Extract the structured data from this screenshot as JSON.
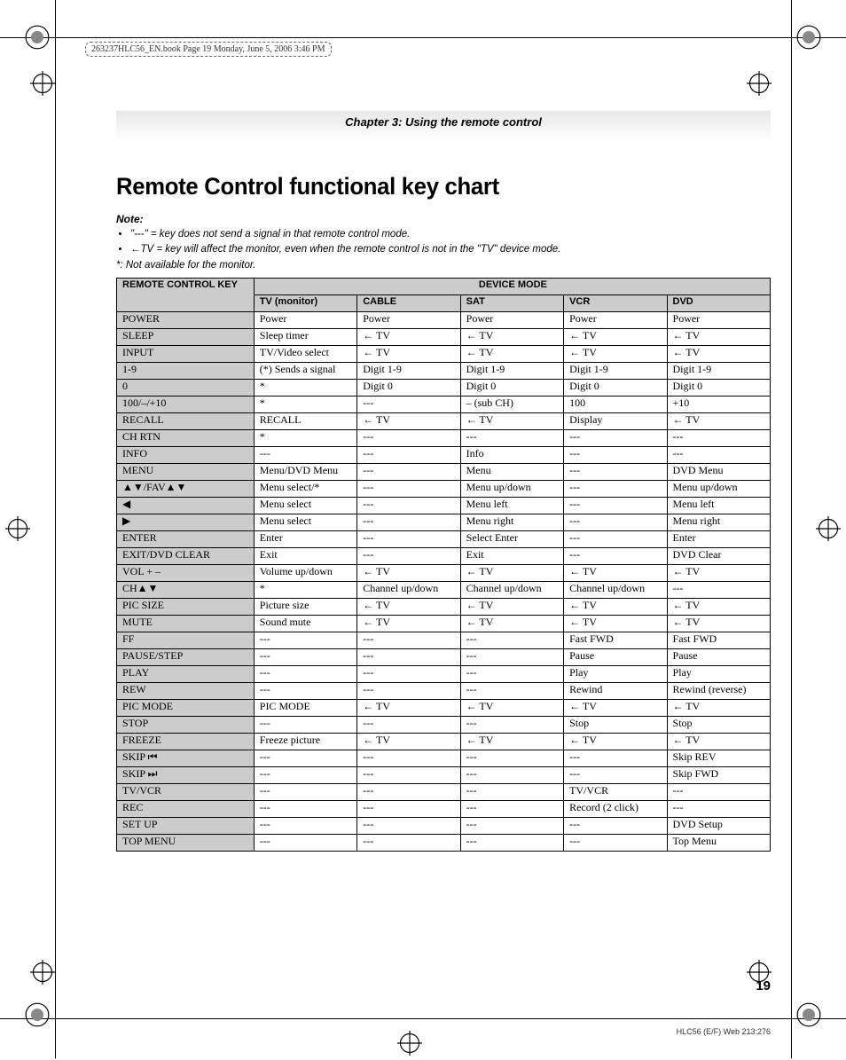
{
  "header_dashed": "263237HLC56_EN.book  Page 19  Monday, June 5, 2006  3:46 PM",
  "chapter": "Chapter 3: Using the remote control",
  "title": "Remote Control functional key chart",
  "note_head": "Note:",
  "notes": [
    "\"---\" = key does not send a signal in that remote control mode.",
    "←TV = key will affect the monitor, even when the remote control is not in the \"TV\" device mode."
  ],
  "note_asterisk": "*: Not available for the monitor.",
  "headers": {
    "remote_key": "REMOTE CONTROL KEY",
    "device_mode": "DEVICE MODE",
    "tv": "TV (monitor)",
    "cable": "CABLE",
    "sat": "SAT",
    "vcr": "VCR",
    "dvd": "DVD"
  },
  "chart_data": {
    "type": "table",
    "columns": [
      "REMOTE CONTROL KEY",
      "TV (monitor)",
      "CABLE",
      "SAT",
      "VCR",
      "DVD"
    ],
    "rows": [
      [
        "POWER",
        "Power",
        "Power",
        "Power",
        "Power",
        "Power"
      ],
      [
        "SLEEP",
        "Sleep timer",
        "← TV",
        "← TV",
        "← TV",
        "← TV"
      ],
      [
        "INPUT",
        "TV/Video select",
        "← TV",
        "← TV",
        "← TV",
        "← TV"
      ],
      [
        "1-9",
        "(*) Sends a signal",
        "Digit 1-9",
        "Digit 1-9",
        "Digit 1-9",
        "Digit 1-9"
      ],
      [
        "0",
        "*",
        "Digit 0",
        "Digit 0",
        "Digit 0",
        "Digit 0"
      ],
      [
        "100/–/+10",
        "*",
        "---",
        "– (sub CH)",
        "100",
        "+10"
      ],
      [
        "RECALL",
        "RECALL",
        "← TV",
        "← TV",
        "Display",
        "← TV"
      ],
      [
        "CH RTN",
        "*",
        "---",
        "---",
        "---",
        "---"
      ],
      [
        "INFO",
        "---",
        "---",
        "Info",
        "---",
        "---"
      ],
      [
        "MENU",
        "Menu/DVD Menu",
        "---",
        "Menu",
        "---",
        "DVD Menu"
      ],
      [
        "▲▼/FAV▲▼",
        "Menu select/*",
        "---",
        "Menu up/down",
        "---",
        "Menu up/down"
      ],
      [
        "◀",
        "Menu select",
        "---",
        "Menu left",
        "---",
        "Menu left"
      ],
      [
        "▶",
        "Menu select",
        "---",
        "Menu right",
        "---",
        "Menu right"
      ],
      [
        "ENTER",
        "Enter",
        "---",
        "Select Enter",
        "---",
        "Enter"
      ],
      [
        "EXIT/DVD CLEAR",
        "Exit",
        "---",
        "Exit",
        "---",
        "DVD Clear"
      ],
      [
        "VOL + –",
        "Volume up/down",
        "← TV",
        "← TV",
        "← TV",
        "← TV"
      ],
      [
        "CH▲▼",
        "*",
        "Channel up/down",
        "Channel up/down",
        "Channel up/down",
        "---"
      ],
      [
        "PIC SIZE",
        "Picture size",
        "← TV",
        "← TV",
        "← TV",
        "← TV"
      ],
      [
        "MUTE",
        "Sound mute",
        "← TV",
        "← TV",
        "← TV",
        "← TV"
      ],
      [
        "FF",
        "---",
        "---",
        "---",
        "Fast FWD",
        "Fast FWD"
      ],
      [
        "PAUSE/STEP",
        "---",
        "---",
        "---",
        "Pause",
        "Pause"
      ],
      [
        "PLAY",
        "---",
        "---",
        "---",
        "Play",
        "Play"
      ],
      [
        "REW",
        "---",
        "---",
        "---",
        "Rewind",
        "Rewind (reverse)"
      ],
      [
        "PIC MODE",
        "PIC MODE",
        "← TV",
        "← TV",
        "← TV",
        "← TV"
      ],
      [
        "STOP",
        "---",
        "---",
        "---",
        "Stop",
        "Stop"
      ],
      [
        "FREEZE",
        "Freeze picture",
        "← TV",
        "← TV",
        "← TV",
        "← TV"
      ],
      [
        "SKIP ⏮",
        "---",
        "---",
        "---",
        "---",
        "Skip REV"
      ],
      [
        "SKIP ⏭",
        "---",
        "---",
        "---",
        "---",
        "Skip FWD"
      ],
      [
        "TV/VCR",
        "---",
        "---",
        "---",
        "TV/VCR",
        "---"
      ],
      [
        "REC",
        "---",
        "---",
        "---",
        "Record (2 click)",
        "---"
      ],
      [
        "SET UP",
        "---",
        "---",
        "---",
        "---",
        "DVD Setup"
      ],
      [
        "TOP MENU",
        "---",
        "---",
        "---",
        "---",
        "Top Menu"
      ]
    ]
  },
  "page_number": "19",
  "footer_id": "HLC56 (E/F) Web 213:276"
}
